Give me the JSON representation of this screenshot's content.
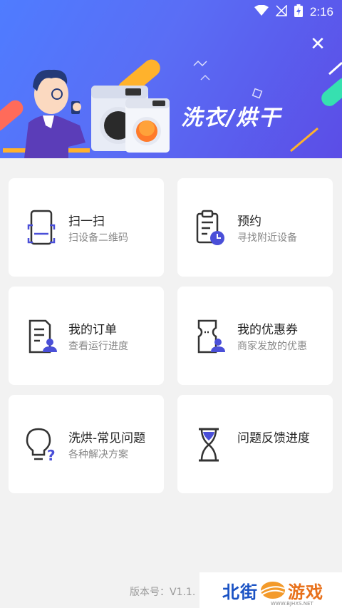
{
  "status_bar": {
    "time": "2:16"
  },
  "banner": {
    "title": "洗衣/烘干"
  },
  "cards": [
    {
      "title": "扫一扫",
      "subtitle": "扫设备二维码",
      "icon": "qr-scan-icon"
    },
    {
      "title": "预约",
      "subtitle": "寻找附近设备",
      "icon": "clipboard-clock-icon"
    },
    {
      "title": "我的订单",
      "subtitle": "查看运行进度",
      "icon": "order-document-icon"
    },
    {
      "title": "我的优惠券",
      "subtitle": "商家发放的优惠",
      "icon": "coupon-user-icon"
    },
    {
      "title": "洗烘-常见问题",
      "subtitle": "各种解决方案",
      "icon": "lightbulb-question-icon"
    },
    {
      "title": "问题反馈进度",
      "subtitle": "",
      "icon": "hourglass-icon"
    }
  ],
  "footer": {
    "version": "版本号：V1.1."
  },
  "watermark": {
    "text_left": "北街",
    "text_right": "游戏",
    "url": "WWW.BJHXS.NET"
  },
  "colors": {
    "accent": "#4a4fd8",
    "banner_start": "#4f7cff",
    "banner_end": "#5b4de6"
  }
}
